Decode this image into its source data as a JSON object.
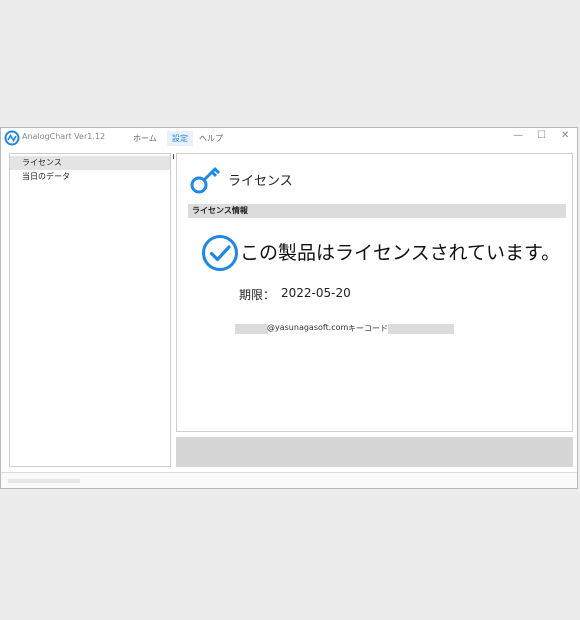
{
  "app": {
    "title": "AnalogChart Ver1.12",
    "accent_color": "#1e88e5"
  },
  "menu": {
    "items": [
      {
        "label": "ホーム"
      },
      {
        "label": "設定"
      },
      {
        "label": "ヘルプ"
      }
    ],
    "selected": "設定"
  },
  "window_controls": {
    "minimize": "—",
    "maximize": "☐",
    "close": "✕"
  },
  "sidebar": {
    "items": [
      {
        "label": "ライセンス",
        "active": true
      },
      {
        "label": "当日のデータ",
        "active": false
      }
    ]
  },
  "license": {
    "header_title": "ライセンス",
    "section_title": "ライセンス情報",
    "status_message": "この製品はライセンスされています。",
    "expiry_label": "期限：",
    "expiry_value": "2022-05-20",
    "email_domain": "@yasunagasoft.com",
    "key_label": "キーコード"
  },
  "icons": {
    "logo": "analogchart-logo-icon",
    "key": "key-icon",
    "check": "check-circle-icon"
  }
}
